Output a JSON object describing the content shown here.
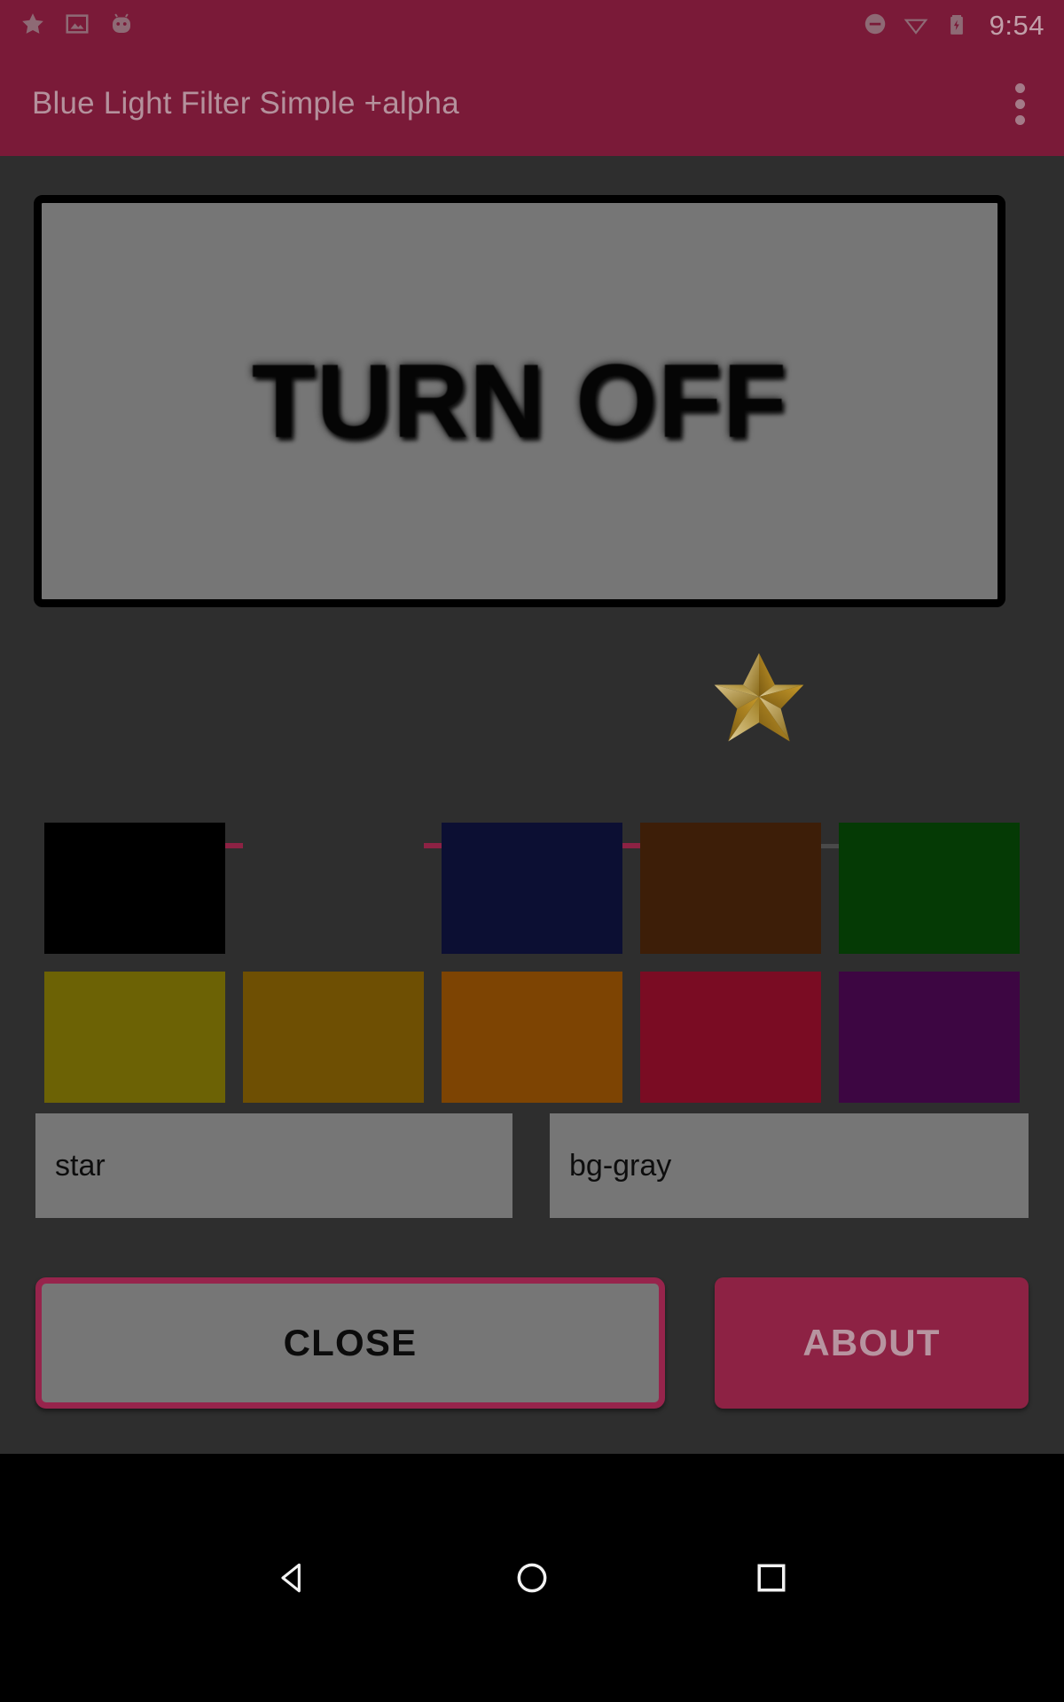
{
  "statusbar": {
    "time": "9:54",
    "left_icons": [
      {
        "name": "star-icon",
        "glyph": "star"
      },
      {
        "name": "image-icon",
        "glyph": "image"
      },
      {
        "name": "android-face-icon",
        "glyph": "android"
      }
    ],
    "right_icons": [
      {
        "name": "do-not-disturb-icon",
        "glyph": "dnd"
      },
      {
        "name": "wifi-icon",
        "glyph": "wifi"
      },
      {
        "name": "battery-charging-icon",
        "glyph": "battery"
      }
    ]
  },
  "appbar": {
    "title": "Blue Light Filter Simple +alpha",
    "overflow_label": "More options"
  },
  "main": {
    "toggle_button_label": "TURN OFF",
    "slider": {
      "value_percent": 69,
      "thumb_icon": "star-thumb-icon",
      "fill_color": "#8d2244",
      "track_color": "#4a4a4a"
    },
    "swatches": [
      {
        "name": "swatch-black",
        "color": "#000000"
      },
      {
        "name": "swatch-dark-gray",
        "color": "#2e2e2e"
      },
      {
        "name": "swatch-navy",
        "color": "#0c0f33"
      },
      {
        "name": "swatch-brown",
        "color": "#3d1e08"
      },
      {
        "name": "swatch-green",
        "color": "#053a05"
      },
      {
        "name": "swatch-olive",
        "color": "#6c6205"
      },
      {
        "name": "swatch-dark-gold",
        "color": "#6e4f03"
      },
      {
        "name": "swatch-orange",
        "color": "#7d4403"
      },
      {
        "name": "swatch-crimson",
        "color": "#7a0c23"
      },
      {
        "name": "swatch-purple",
        "color": "#3d0642"
      }
    ],
    "fields": [
      {
        "name": "star-field",
        "value": "star",
        "placeholder": "star"
      },
      {
        "name": "bg-gray-field",
        "value": "bg-gray",
        "placeholder": "bg-gray"
      }
    ],
    "close_button_label": "CLOSE",
    "about_button_label": "ABOUT"
  },
  "navbar": {
    "back_label": "Back",
    "home_label": "Home",
    "recents_label": "Recents"
  }
}
